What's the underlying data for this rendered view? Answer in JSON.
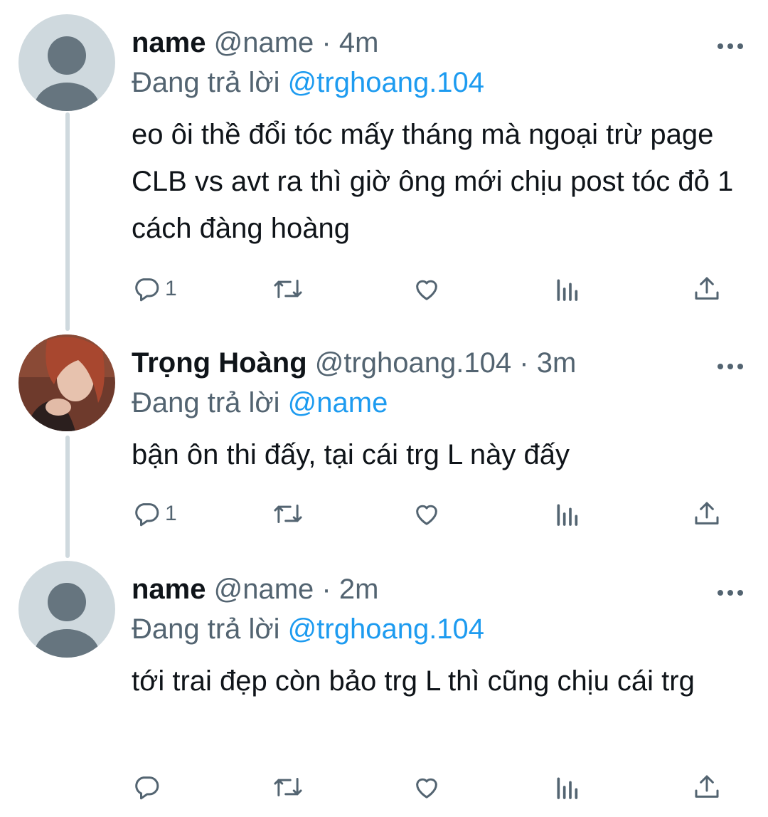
{
  "tweets": [
    {
      "display_name": "name",
      "handle": "@name",
      "time": "4m",
      "reply_prefix": "Đang trả lời",
      "reply_to": "@trghoang.104",
      "text": "eo ôi thề đổi tóc mấy tháng mà ngoại trừ page CLB vs avt ra thì giờ ông mới chịu post tóc đỏ 1 cách đàng hoàng",
      "reply_count": "1",
      "avatar": "default-avatar"
    },
    {
      "display_name": "Trọng Hoàng",
      "handle": "@trghoang.104",
      "time": "3m",
      "reply_prefix": "Đang trả lời",
      "reply_to": "@name",
      "text": "bận ôn thi đấy, tại cái trg L này đấy",
      "reply_count": "1",
      "avatar": "photo-avatar"
    },
    {
      "display_name": "name",
      "handle": "@name",
      "time": "2m",
      "reply_prefix": "Đang trả lời",
      "reply_to": "@trghoang.104",
      "text": "tới trai đẹp còn bảo trg L thì cũng chịu cái trg",
      "reply_count": "",
      "avatar": "default-avatar"
    }
  ],
  "separator": "·",
  "icons": [
    "reply-icon",
    "retweet-icon",
    "like-icon",
    "views-icon",
    "share-icon",
    "more-icon"
  ],
  "colors": {
    "accent": "#1d9bf0",
    "secondary_text": "#536471",
    "thread_line": "#cfd9de"
  }
}
